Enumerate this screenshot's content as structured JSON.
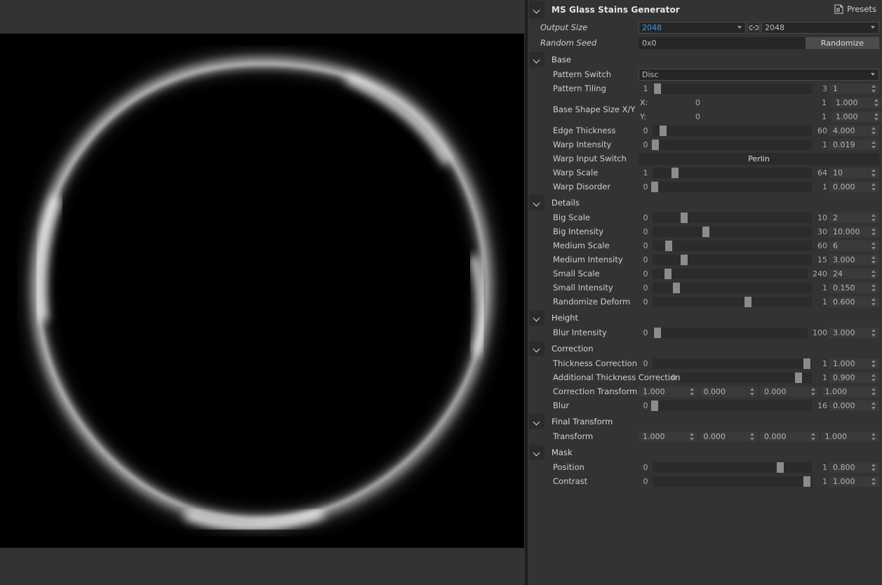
{
  "node": {
    "title": "MS Glass Stains Generator",
    "presets_label": "Presets",
    "collapse_icon": "chevron-down-icon",
    "presets_icon": "presets-document-icon"
  },
  "top": {
    "output_size": {
      "label": "Output Size",
      "value_x": "2048",
      "value_y": "2048",
      "link_icon": "link-chain-icon"
    },
    "random_seed": {
      "label": "Random Seed",
      "value": "0x0",
      "button_label": "Randomize"
    }
  },
  "sections": [
    {
      "name": "Base",
      "rows": [
        {
          "type": "combo",
          "label": "Pattern Switch",
          "value": "Disc"
        },
        {
          "type": "slider",
          "label": "Pattern Tiling",
          "min": "1",
          "max": "3",
          "value": "1",
          "fill": 0.03
        },
        {
          "type": "xy",
          "label": "Base Shape Size X/Y",
          "x": {
            "axis": "X:",
            "min": "0",
            "max": "1",
            "value": "1.000",
            "fill": 0.955
          },
          "y": {
            "axis": "Y:",
            "min": "0",
            "max": "1",
            "value": "1.000",
            "fill": 0.955
          }
        },
        {
          "type": "slider",
          "label": "Edge Thickness",
          "min": "0",
          "max": "60",
          "value": "4.000",
          "fill": 0.064
        },
        {
          "type": "slider",
          "label": "Warp Intensity",
          "min": "0",
          "max": "1",
          "value": "0.019",
          "fill": 0.019
        },
        {
          "type": "flatbtn",
          "label": "Warp Input Switch",
          "value": "Perlin"
        },
        {
          "type": "slider",
          "label": "Warp Scale",
          "min": "1",
          "max": "64",
          "value": "10",
          "fill": 0.143
        },
        {
          "type": "slider",
          "label": "Warp Disorder",
          "min": "0",
          "max": "1",
          "value": "0.000",
          "fill": 0.0
        }
      ]
    },
    {
      "name": "Details",
      "rows": [
        {
          "type": "slider",
          "label": "Big Scale",
          "min": "0",
          "max": "10",
          "value": "2",
          "fill": 0.2
        },
        {
          "type": "slider",
          "label": "Big Intensity",
          "min": "0",
          "max": "30",
          "value": "10.000",
          "fill": 0.333
        },
        {
          "type": "slider",
          "label": "Medium Scale",
          "min": "0",
          "max": "60",
          "value": "6",
          "fill": 0.1
        },
        {
          "type": "slider",
          "label": "Medium Intensity",
          "min": "0",
          "max": "15",
          "value": "3.000",
          "fill": 0.2
        },
        {
          "type": "slider",
          "label": "Small Scale",
          "min": "0",
          "max": "240",
          "value": "24",
          "fill": 0.1
        },
        {
          "type": "slider",
          "label": "Small Intensity",
          "min": "0",
          "max": "1",
          "value": "0.150",
          "fill": 0.15
        },
        {
          "type": "slider",
          "label": "Randomize Deform",
          "min": "0",
          "max": "1",
          "value": "0.600",
          "fill": 0.6
        }
      ]
    },
    {
      "name": "Height",
      "rows": [
        {
          "type": "slider",
          "label": "Blur Intensity",
          "min": "0",
          "max": "100",
          "value": "3.000",
          "fill": 0.03
        }
      ]
    },
    {
      "name": "Correction",
      "rows": [
        {
          "type": "slider",
          "label": "Thickness Correction",
          "min": "0",
          "max": "1",
          "value": "1.000",
          "fill": 0.97
        },
        {
          "type": "slider-wide",
          "label": "Additional Thickness Correction",
          "min": "0",
          "max": "1",
          "value": "0.900",
          "fill": 0.9
        },
        {
          "type": "quad",
          "label": "Correction Transform",
          "values": [
            "1.000",
            "0.000",
            "0.000",
            "1.000"
          ]
        },
        {
          "type": "slider",
          "label": "Blur",
          "min": "0",
          "max": "16",
          "value": "0.000",
          "fill": 0.0
        }
      ]
    },
    {
      "name": "Final Transform",
      "rows": [
        {
          "type": "quad",
          "label": "Transform",
          "values": [
            "1.000",
            "0.000",
            "0.000",
            "1.000"
          ]
        }
      ]
    },
    {
      "name": "Mask",
      "rows": [
        {
          "type": "slider",
          "label": "Position",
          "min": "0",
          "max": "1",
          "value": "0.800",
          "fill": 0.8
        },
        {
          "type": "slider",
          "label": "Contrast",
          "min": "0",
          "max": "1",
          "value": "1.000",
          "fill": 0.97
        }
      ]
    }
  ],
  "preview": {
    "alt": "glass-stain-ring-preview",
    "background": "#000000",
    "pane_background": "#333333"
  },
  "colors": {
    "panel_bg": "#333333",
    "accent_blue": "#3c9ae8",
    "track": "#2b2b2b",
    "handle": "#8c8c8c",
    "field_bg": "#262626",
    "spin_bg": "#3a3a3a"
  }
}
